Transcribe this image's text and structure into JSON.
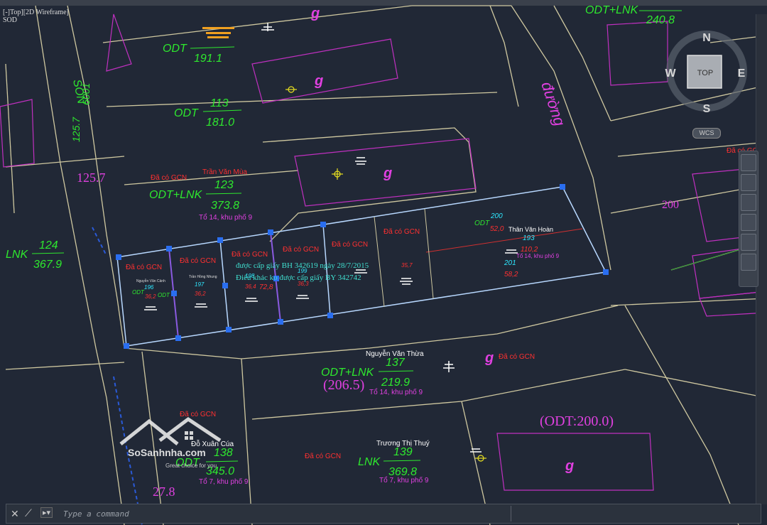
{
  "window": {
    "file_tab": "[-]Top][2D Wireframe]",
    "file_tab_sub": "SOD"
  },
  "viewcube": {
    "north": "N",
    "south": "S",
    "east": "E",
    "west": "W",
    "face": "TOP",
    "wcs": "WCS"
  },
  "command": {
    "placeholder": "Type a command"
  },
  "watermark": {
    "brand": "SoSanhnha.com",
    "slogan": "Great choice for you"
  },
  "colors": {
    "background": "#212836",
    "parcel_line": "#cfc8a0",
    "highlight": "#b8d8ff",
    "magenta": "#e040e0",
    "green": "#2ee82e",
    "red": "#ff3030"
  },
  "labels": {
    "street_word": "đường",
    "son_label": "SON",
    "son_num": "6001",
    "son_val": "125.7",
    "val_125_magenta": "125.7",
    "val_200": "200",
    "odt_200": "(ODT:200.0)",
    "val_206": "(206.5)",
    "val_27": "27.8",
    "g1": "g",
    "g2": "g",
    "g3": "g",
    "g4": "g",
    "g5": "g",
    "top_odt_lnk": "ODT+LNK",
    "top_240": "240.8",
    "odt_191_code": "ODT",
    "odt_191": "191.1",
    "odt_113_code": "ODT",
    "odt_113": "113",
    "odt_181": "181.0",
    "p123_owner": "Trần Văn Mùa",
    "p123_gcn": "Đã có GCN",
    "p123_code": "ODT+LNK",
    "p123_num": "123",
    "p123_area": "373.8",
    "p123_addr": "Tổ 14, khu phố 9",
    "p124_code": "LNK",
    "p124_num": "124",
    "p124_area": "367.9",
    "p137_owner": "Nguyễn Văn Thừa",
    "p137_gcn": "Đã có GCN",
    "p137_code": "ODT+LNK",
    "p137_num": "137",
    "p137_area": "219.9",
    "p137_addr": "Tổ 14, khu phố 9",
    "p138_owner": "Đỗ Xuân Cúa",
    "p138_gcn": "Đã có GCN",
    "p138_code": "ODT",
    "p138_num": "138",
    "p138_area": "345.0",
    "p138_addr": "Tổ 7, khu phố 9",
    "p139_owner": "Trương Thị Thuý",
    "p139_gcn": "Đã có GCN",
    "p139_code": "LNK",
    "p139_num": "139",
    "p139_area": "369.8",
    "p139_addr": "Tổ 7, khu phố 9",
    "p193_owner": "Thân Văn Hoàn",
    "p193_num": "193",
    "p193_area": "110,2",
    "p193_addr": "Tổ 14, khu phố 9",
    "p200_num": "200",
    "p200_area": "52,0",
    "p201_num": "201",
    "p201_area": "58,2",
    "odt_a": "ODT",
    "odt_b": "ODT",
    "odt_c": "ODT",
    "gcn_a": "Đã có GCN",
    "gcn_b": "Đã có GCN",
    "gcn_c": "Đã có GCN",
    "gcn_d": "Đã có GCN",
    "gcn_e": "Đã có GCN",
    "gcn_f": "Đã có GCN",
    "gcn_right": "Đã có GCN",
    "p196": "196",
    "p196a": "36,2",
    "p197": "197",
    "p197a": "36,2",
    "p198": "198",
    "p198a": "36,4",
    "p199": "199",
    "p199a": "36,3",
    "p72": "72,8",
    "p357": "35,7",
    "note1": "được cấp giấy BH 342619 ngày 28/7/2015",
    "note2": "Điểu khác ko được cấp giấy BY 342742",
    "khu_small": "Tổ 14, khu phố 9",
    "name_small1": "Nguyễn Văn Cảnh",
    "name_small2": "Trần Hồng Nhung"
  }
}
